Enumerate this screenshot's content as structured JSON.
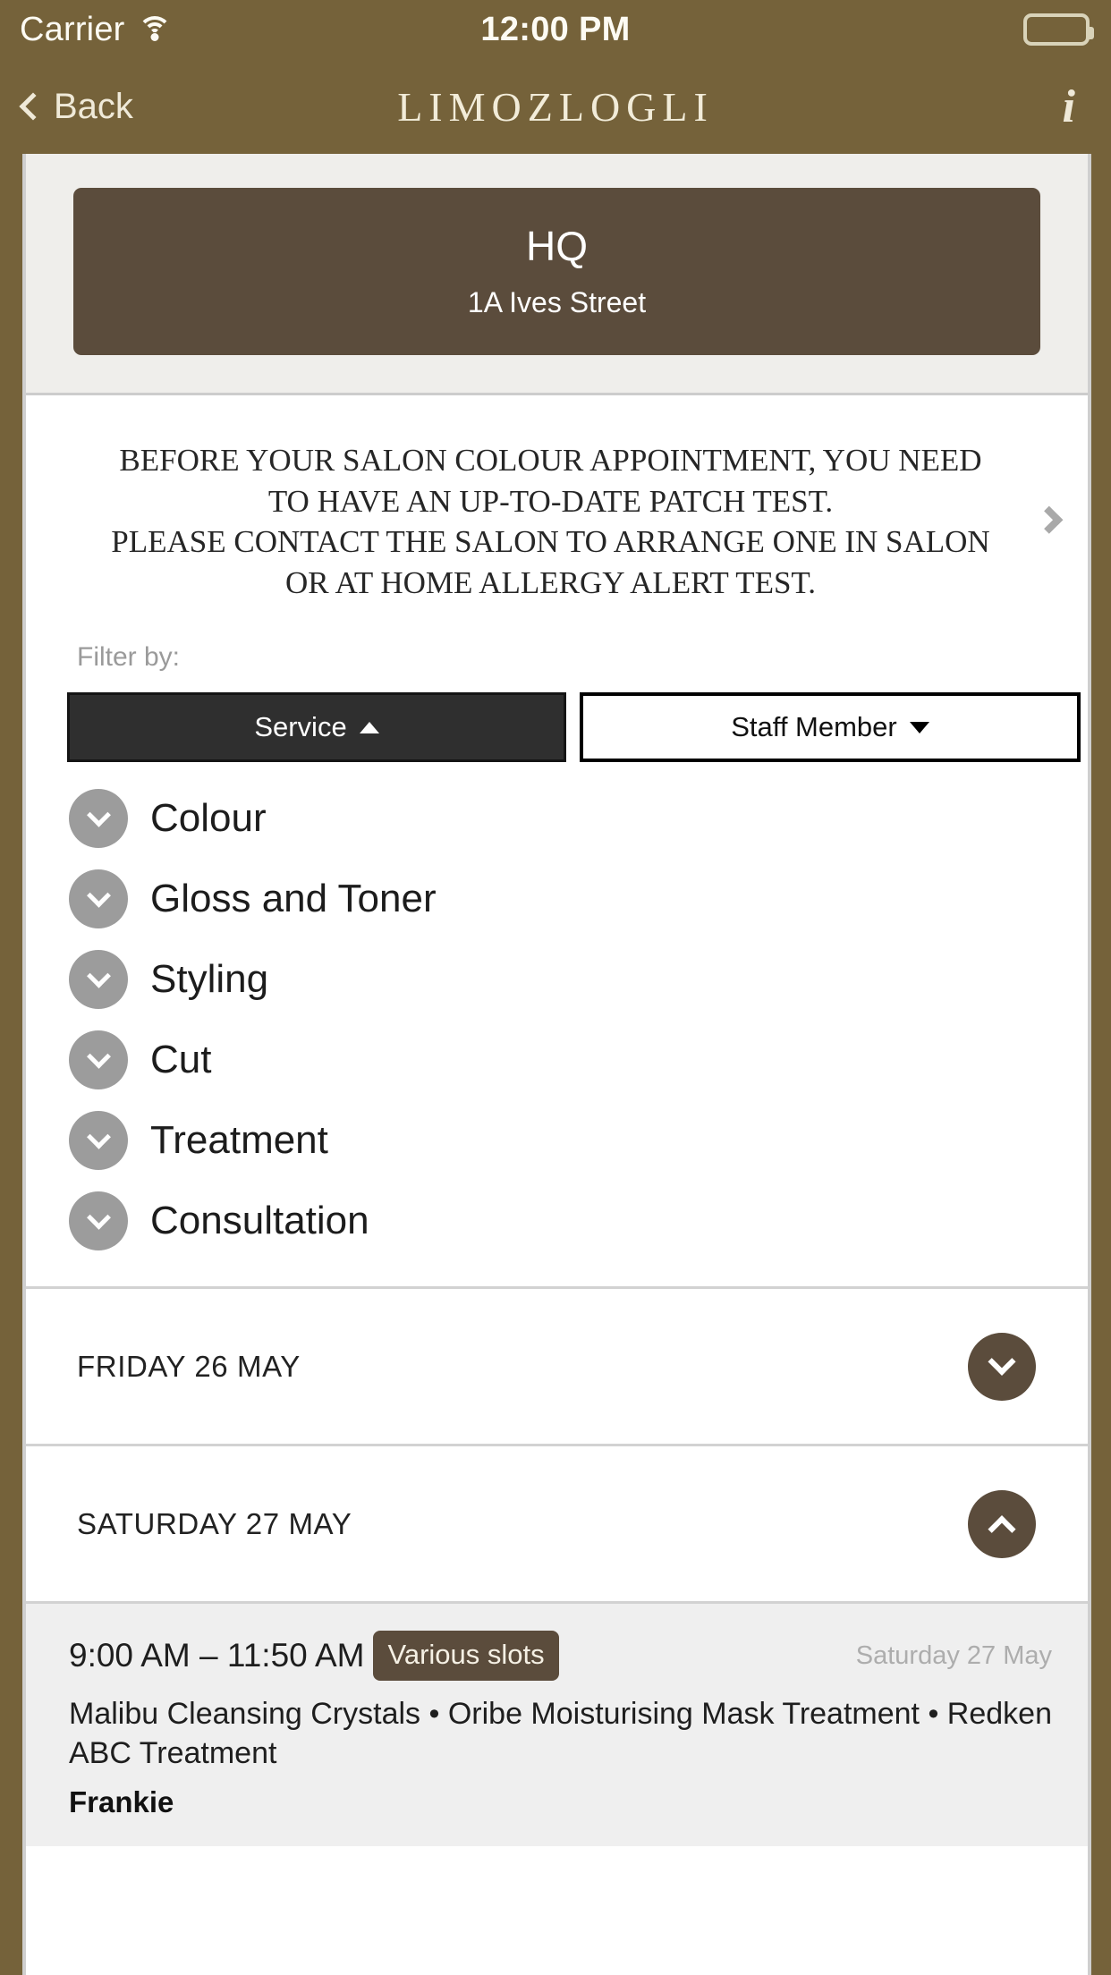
{
  "status_bar": {
    "carrier": "Carrier",
    "time": "12:00 PM",
    "wifi_icon": "wifi-icon",
    "battery_icon": "battery-full-icon"
  },
  "nav": {
    "back_label": "Back",
    "back_icon": "chevron-left-icon",
    "title": "LIMOZLOGLI",
    "info_icon": "info-icon",
    "info_glyph": "i"
  },
  "venue": {
    "name": "HQ",
    "address": "1A Ives Street"
  },
  "notice": {
    "lines": [
      "BEFORE YOUR SALON COLOUR APPOINTMENT, YOU NEED",
      "TO HAVE AN UP-TO-DATE PATCH TEST.",
      "PLEASE CONTACT THE SALON TO ARRANGE ONE IN SALON",
      "OR AT HOME ALLERGY ALERT TEST."
    ],
    "chevron_icon": "chevron-right-icon"
  },
  "filter": {
    "label": "Filter by:",
    "service_tab": {
      "label": "Service",
      "state": "active",
      "arrow": "triangle-up-icon"
    },
    "staff_tab": {
      "label": "Staff Member",
      "state": "inactive",
      "arrow": "triangle-down-icon"
    }
  },
  "services": [
    {
      "label": "Colour"
    },
    {
      "label": "Gloss and Toner"
    },
    {
      "label": "Styling"
    },
    {
      "label": "Cut"
    },
    {
      "label": "Treatment"
    },
    {
      "label": "Consultation"
    }
  ],
  "days": [
    {
      "label": "FRIDAY 26 MAY",
      "expanded": false,
      "toggle_icon": "chevron-down-icon"
    },
    {
      "label": "SATURDAY 27 MAY",
      "expanded": true,
      "toggle_icon": "chevron-up-icon"
    }
  ],
  "appointments": [
    {
      "time_range": "9:00 AM – 11:50 AM",
      "badge": "Various slots",
      "date": "Saturday 27 May",
      "services": "Malibu Cleansing Crystals • Oribe Moisturising Mask Treatment • Redken ABC Treatment",
      "staff": "Frankie"
    }
  ],
  "colors": {
    "brand_brown": "#75623a",
    "card_brown": "#5b4c3c",
    "accent_dark": "#2f2f2f",
    "muted_gray": "#9c9c9c",
    "panel_gray": "#efeeeb"
  }
}
